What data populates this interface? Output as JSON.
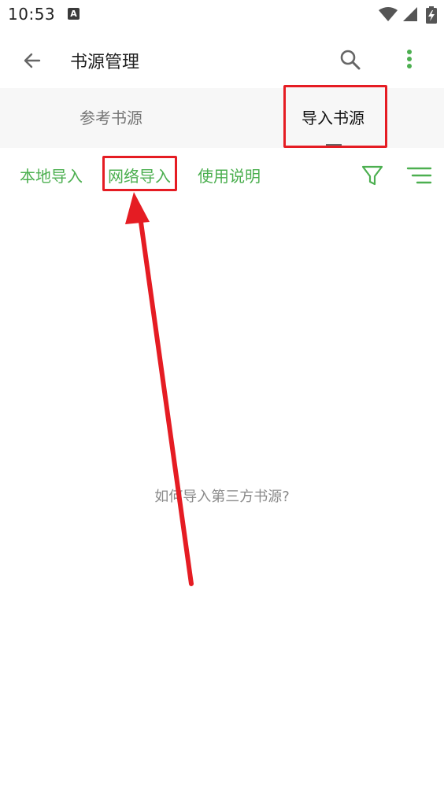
{
  "status_bar": {
    "time": "10:53",
    "notification_letter": "A",
    "icons": [
      "wifi-icon",
      "signal-icon",
      "battery-charging-icon"
    ]
  },
  "app_bar": {
    "title": "书源管理",
    "icons": [
      "back-arrow-icon",
      "search-icon",
      "more-vert-icon"
    ]
  },
  "tabs": [
    {
      "label": "参考书源",
      "selected": false
    },
    {
      "label": "导入书源",
      "selected": true
    }
  ],
  "actions": {
    "local_import": "本地导入",
    "network_import": "网络导入",
    "instructions": "使用说明",
    "icons": [
      "filter-icon",
      "sort-icon"
    ]
  },
  "empty_hint": "如何导入第三方书源?",
  "colors": {
    "accent": "#4caf50",
    "tab_background": "#f7f7f7",
    "annotation": "#e51c23"
  }
}
